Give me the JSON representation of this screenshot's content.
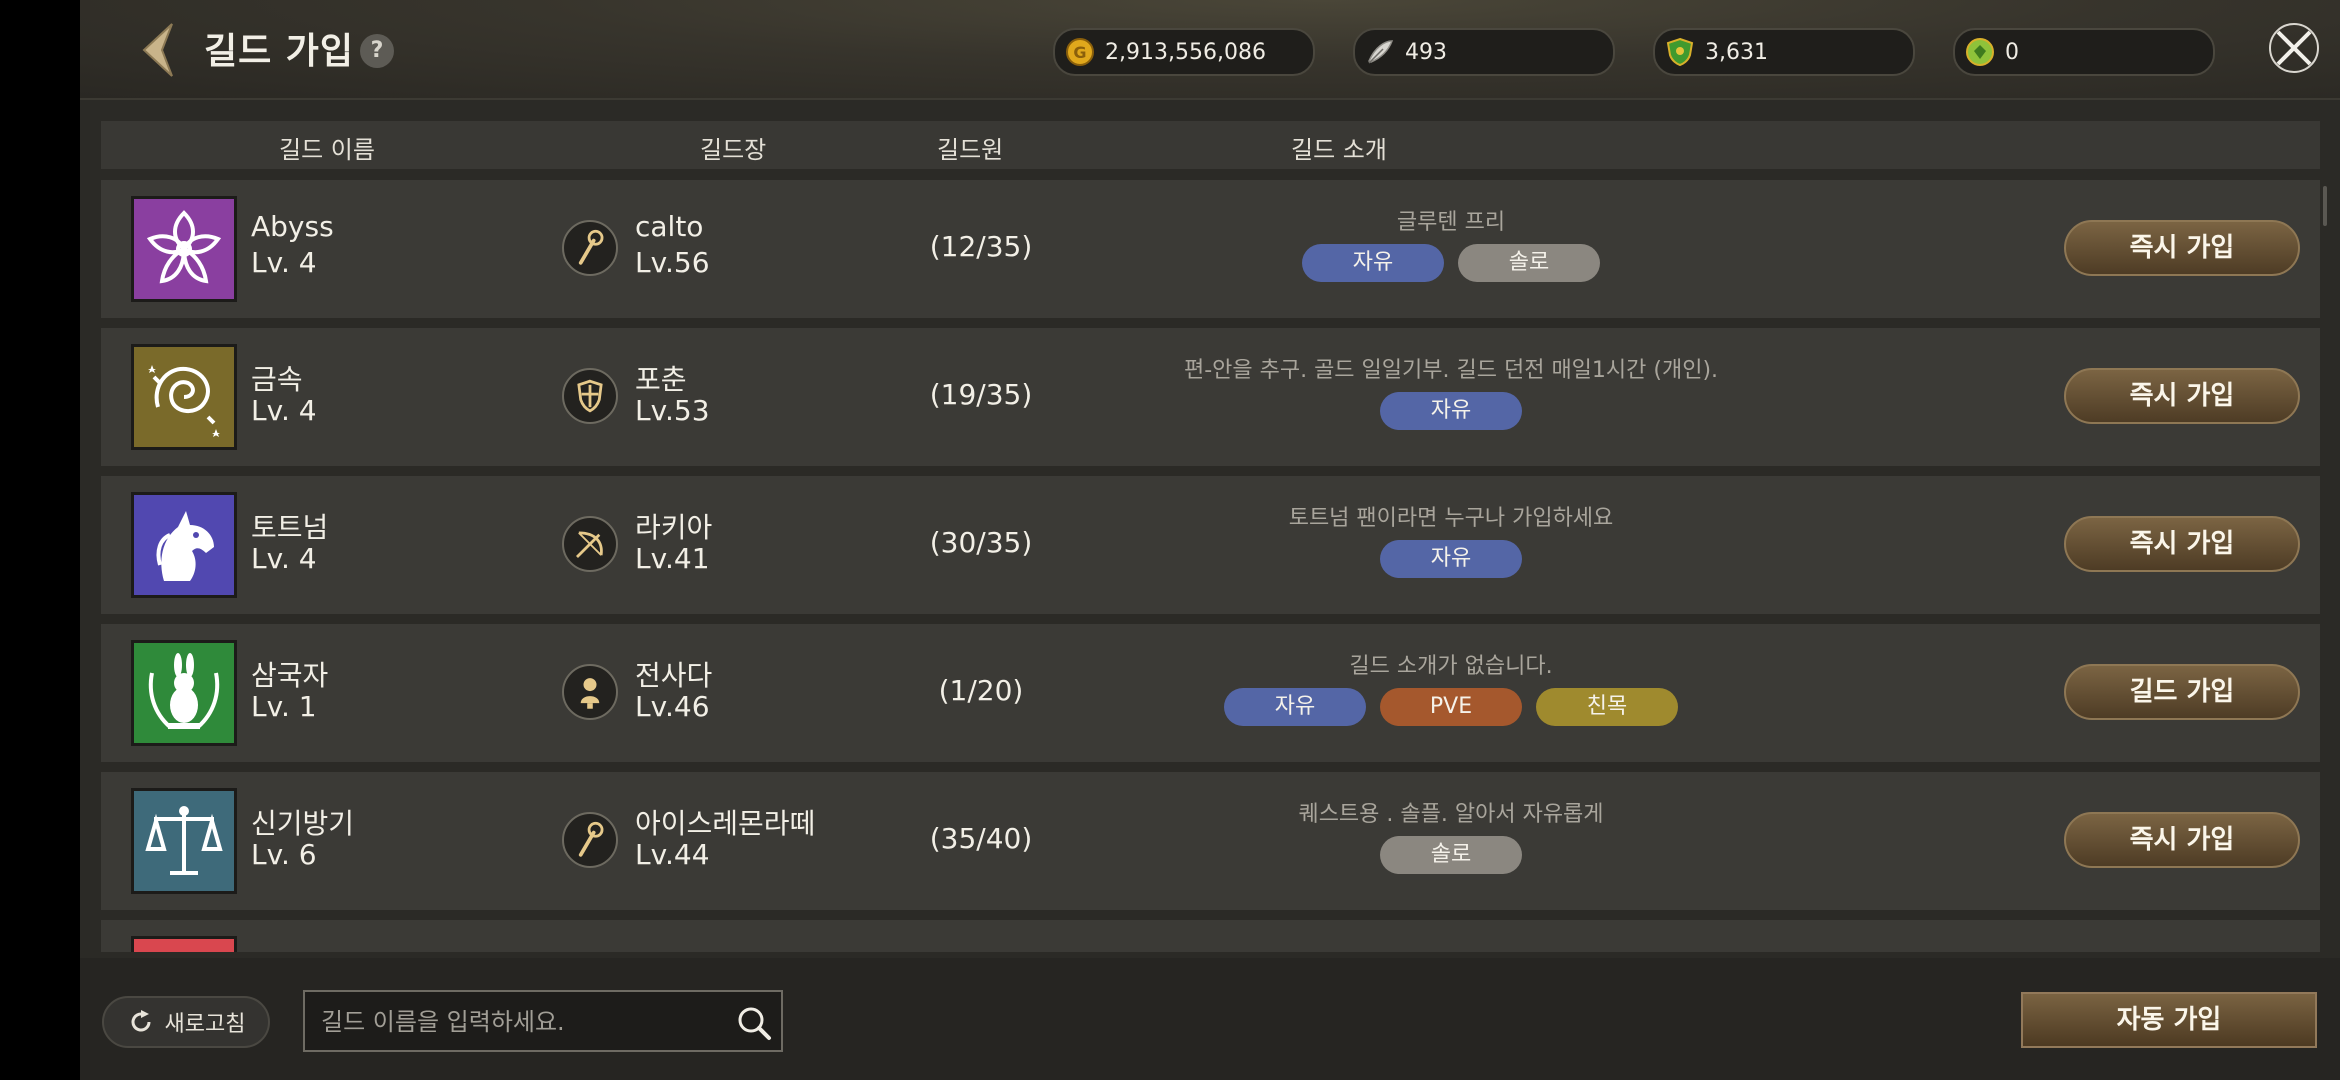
{
  "header": {
    "title": "길드 가입",
    "help_label": "?",
    "currencies": [
      {
        "icon": "gold-coin-icon",
        "value": "2,913,556,086"
      },
      {
        "icon": "feather-icon",
        "value": "493"
      },
      {
        "icon": "guild-shield-icon",
        "value": "3,631"
      },
      {
        "icon": "green-gem-icon",
        "value": "0"
      }
    ]
  },
  "table": {
    "columns": [
      "길드 이름",
      "길드장",
      "길드원",
      "길드 소개"
    ]
  },
  "guilds": [
    {
      "name": "Abyss",
      "level": "Lv. 4",
      "emblem": "flower-emblem",
      "emblem_color": "#8a3fa0",
      "leader": "calto",
      "leader_level": "Lv.56",
      "leader_class": "staff-icon",
      "members": "(12/35)",
      "intro": "글루텐 프리",
      "tags": [
        {
          "label": "자유",
          "type": "free"
        },
        {
          "label": "솔로",
          "type": "solo"
        }
      ],
      "button": "즉시 가입"
    },
    {
      "name": "금속",
      "level": "Lv. 4",
      "emblem": "swirl-emblem",
      "emblem_color": "#7a6a2a",
      "leader": "포춘",
      "leader_level": "Lv.53",
      "leader_class": "shield-icon",
      "members": "(19/35)",
      "intro": "편-안을 추구.  골드 일일기부. 길드 던전 매일1시간 (개인).",
      "tags": [
        {
          "label": "자유",
          "type": "free"
        }
      ],
      "button": "즉시 가입"
    },
    {
      "name": "토트넘",
      "level": "Lv. 4",
      "emblem": "unicorn-emblem",
      "emblem_color": "#5148b0",
      "leader": "라키아",
      "leader_level": "Lv.41",
      "leader_class": "bow-icon",
      "members": "(30/35)",
      "intro": "토트넘 팬이라면 누구나 가입하세요",
      "tags": [
        {
          "label": "자유",
          "type": "free"
        }
      ],
      "button": "즉시 가입"
    },
    {
      "name": "삼국자",
      "level": "Lv. 1",
      "emblem": "rabbit-emblem",
      "emblem_color": "#2f8a3a",
      "leader": "전사다",
      "leader_level": "Lv.46",
      "leader_class": "warrior-icon",
      "members": "(1/20)",
      "intro": "길드 소개가 없습니다.",
      "tags": [
        {
          "label": "자유",
          "type": "free"
        },
        {
          "label": "PVE",
          "type": "pve"
        },
        {
          "label": "친목",
          "type": "friend"
        }
      ],
      "button": "길드 가입"
    },
    {
      "name": "신기방기",
      "level": "Lv. 6",
      "emblem": "scales-emblem",
      "emblem_color": "#3e6a7a",
      "leader": "아이스레몬라떼",
      "leader_level": "Lv.44",
      "leader_class": "staff-icon",
      "members": "(35/40)",
      "intro": "퀘스트용 . 솔플. 알아서 자유롭게",
      "tags": [
        {
          "label": "솔로",
          "type": "solo"
        }
      ],
      "button": "즉시 가입"
    }
  ],
  "footer": {
    "refresh_label": "새로고침",
    "search_placeholder": "길드 이름을 입력하세요.",
    "auto_join_label": "자동 가입"
  }
}
